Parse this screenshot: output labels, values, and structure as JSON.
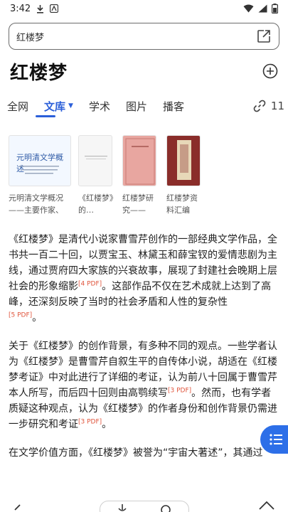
{
  "status": {
    "time": "3:42"
  },
  "search": {
    "query": "红楼梦"
  },
  "page_title": "红楼梦",
  "tabs": [
    {
      "label": "全网"
    },
    {
      "label": "文库"
    },
    {
      "label": "学术"
    },
    {
      "label": "图片"
    },
    {
      "label": "播客"
    }
  ],
  "link_count": "11",
  "documents": [
    {
      "label": "元明清文学概况——主要作家、作…",
      "thumb_title": "元明清文学概述"
    },
    {
      "label": "《红楼梦》的…"
    },
    {
      "label": "红楼梦研究——据…"
    },
    {
      "label": "红楼梦资料汇编"
    }
  ],
  "article": {
    "p1": [
      "《红楼梦》是清代小说家曹雪芹创作的一部经典文学作品，全书共一百二十回，以贾宝玉、林黛玉和薛宝钗的爱情悲剧为主线，通过贾府四大家族的兴衰故事，展现了封建社会晚期上层社会的形象缩影",
      "[4 PDF]",
      "。这部作品不仅在艺术成就上达到了高峰，还深刻反映了当时的社会矛盾和人性的复杂性",
      "[5 PDF]",
      "。"
    ],
    "p2": [
      "关于《红楼梦》的创作背景，有多种不同的观点。一些学者认为《红楼梦》是曹雪芹自叙生平的自传体小说，胡适在《红楼梦考证》中对此进行了详细的考证，认为前八十回属于曹雪芹本人所写，而后四十回则由高鹗续写",
      "[3 PDF]",
      "。然而，也有学者质疑这种观点，认为《红楼梦》的作者身份和创作背景仍需进一步研究和考证",
      "[3 PDF]",
      "。"
    ],
    "p3": "在文学价值方面，《红楼梦》被誉为“宇宙大著述”，其通过"
  },
  "colors": {
    "accent": "#2b5fd9",
    "citation": "#e0553c",
    "fab": "#2d6fe8"
  }
}
